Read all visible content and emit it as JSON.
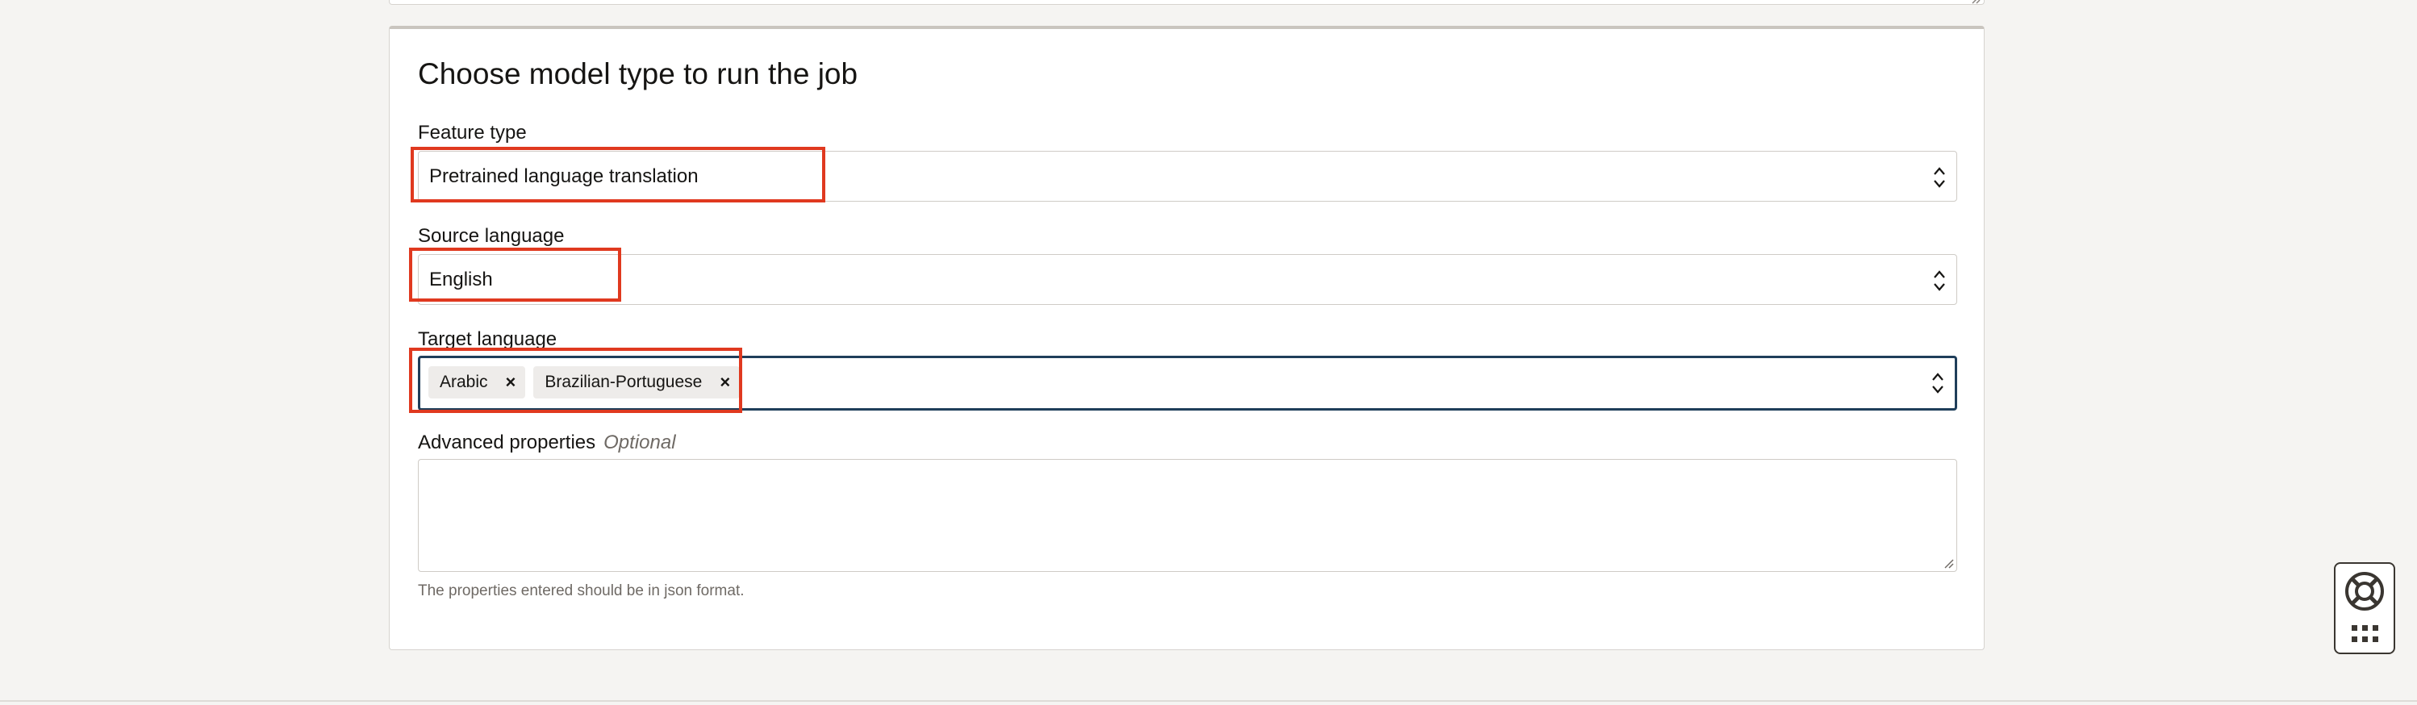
{
  "form": {
    "title": "Choose model type to run the job",
    "feature_type": {
      "label": "Feature type",
      "value": "Pretrained language translation"
    },
    "source_language": {
      "label": "Source language",
      "value": "English"
    },
    "target_language": {
      "label": "Target language",
      "chips": [
        "Arabic",
        "Brazilian-Portuguese"
      ],
      "remove_glyph": "×"
    },
    "advanced_properties": {
      "label": "Advanced properties",
      "optional_label": "Optional",
      "value": "",
      "help_text": "The properties entered should be in json format."
    }
  },
  "colors": {
    "highlight": "#e0391f",
    "focus_border": "#1f3e5a",
    "background": "#f5f4f2"
  },
  "icons": {
    "select_chevron": "chevron-up-down-icon",
    "help": "lifebuoy-icon",
    "apps": "grid-dots-icon"
  }
}
